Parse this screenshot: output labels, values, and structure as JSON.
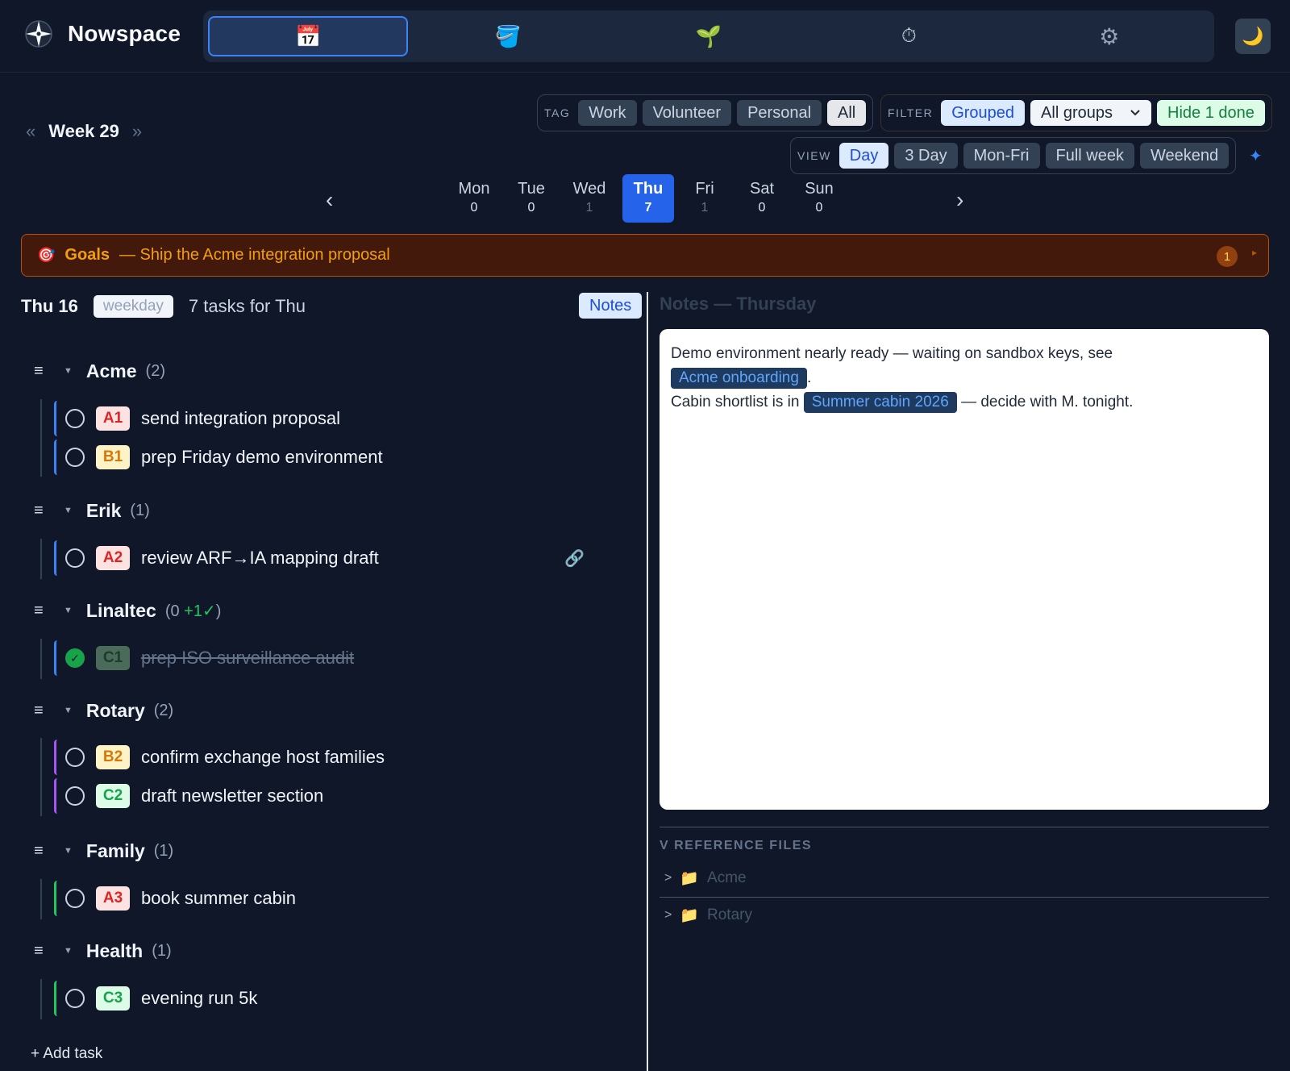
{
  "app": {
    "name": "Nowspace"
  },
  "nav": {
    "tabs": [
      {
        "id": "calendar",
        "icon": "calendar-icon",
        "glyph": "📅"
      },
      {
        "id": "bucket",
        "icon": "bucket-icon",
        "glyph": "🪣"
      },
      {
        "id": "sprout",
        "icon": "sprout-icon",
        "glyph": "🌱"
      },
      {
        "id": "timer",
        "icon": "stopwatch-icon",
        "glyph": "⏱"
      },
      {
        "id": "settings",
        "icon": "gear-icon",
        "glyph": "⚙"
      }
    ],
    "theme_glyph": "🌙"
  },
  "week": {
    "title": "Week 29",
    "prev": "«",
    "next": "»"
  },
  "tag_filter": {
    "label": "TAG",
    "options": [
      "Work",
      "Volunteer",
      "Personal",
      "All"
    ],
    "selected": "All"
  },
  "filter": {
    "label": "FILTER",
    "grouped": "Grouped",
    "group_select": "All groups",
    "hide_done": "Hide 1 done"
  },
  "view": {
    "label": "VIEW",
    "options": [
      "Day",
      "3 Day",
      "Mon-Fri",
      "Full week",
      "Weekend"
    ],
    "selected": "Day",
    "sparkle": "✦"
  },
  "days": [
    {
      "name": "Mon",
      "count": "0",
      "dim": false
    },
    {
      "name": "Tue",
      "count": "0",
      "dim": false
    },
    {
      "name": "Wed",
      "count": "1",
      "dim": true
    },
    {
      "name": "Thu",
      "count": "7",
      "dim": false,
      "active": true
    },
    {
      "name": "Fri",
      "count": "1",
      "dim": true
    },
    {
      "name": "Sat",
      "count": "0",
      "dim": false
    },
    {
      "name": "Sun",
      "count": "0",
      "dim": false
    }
  ],
  "day_nav": {
    "prev": "‹",
    "next": "›"
  },
  "goals": {
    "icon": "🎯",
    "label": "Goals",
    "text": "— Ship the Acme integration proposal",
    "count": "1",
    "expand": "▸"
  },
  "day_header": {
    "date": "Thu 16",
    "type": "weekday",
    "count_text": "7 tasks for Thu",
    "notes_button": "Notes"
  },
  "groups": [
    {
      "name": "Acme",
      "count": "(2)",
      "tasks": [
        {
          "code": "A1",
          "title": "send integration proposal",
          "pri": "a"
        },
        {
          "code": "B1",
          "title": "prep Friday demo environment",
          "pri": "b"
        }
      ]
    },
    {
      "name": "Erik",
      "count": "(1)",
      "tasks": [
        {
          "code": "A2",
          "title": "review ARF→IA mapping draft",
          "pri": "a",
          "link": "🔗"
        }
      ]
    },
    {
      "name": "Linaltec",
      "count_open": "(0 ",
      "count_done": "+1✓",
      "count_close": ")",
      "tasks": [
        {
          "code": "C1",
          "title": "prep ISO surveillance audit",
          "pri": "cd",
          "done": true
        }
      ]
    },
    {
      "name": "Rotary",
      "count": "(2)",
      "tasks": [
        {
          "code": "B2",
          "title": "confirm exchange host families",
          "pri": "b"
        },
        {
          "code": "C2",
          "title": "draft newsletter section",
          "pri": "c"
        }
      ]
    },
    {
      "name": "Family",
      "count": "(1)",
      "tasks": [
        {
          "code": "A3",
          "title": "book summer cabin",
          "pri": "a"
        }
      ]
    },
    {
      "name": "Health",
      "count": "(1)",
      "tasks": [
        {
          "code": "C3",
          "title": "evening run 5k",
          "pri": "c"
        }
      ]
    }
  ],
  "add_task": "+ Add task",
  "notes": {
    "title": "Notes — Thursday",
    "line1": "Demo environment nearly ready — waiting on sandbox keys, see",
    "chip1": "Acme onboarding",
    "line1_end": ".",
    "line2_start": "Cabin shortlist is in",
    "chip2": "Summer cabin 2026",
    "line2_end": "— decide with M. tonight."
  },
  "reference": {
    "title": "V REFERENCE FILES",
    "items": [
      {
        "chevron": ">",
        "icon": "📁",
        "name": "Acme"
      },
      {
        "chevron": ">",
        "icon": "📁",
        "name": "Rotary"
      }
    ]
  },
  "colors": {
    "accent": "#3b82f6",
    "background": "#0f1729",
    "goals_bg": "#42190a",
    "goals_text": "#f59e0b"
  }
}
